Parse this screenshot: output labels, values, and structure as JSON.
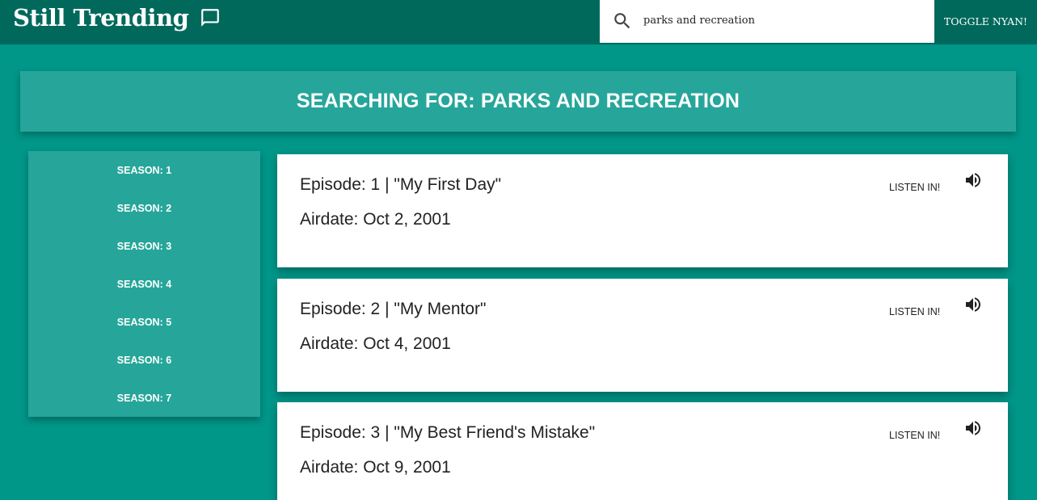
{
  "header": {
    "title": "Still Trending",
    "title_icon": "chat-bubble-icon",
    "search": {
      "icon": "search-icon",
      "value": "parks and recreation"
    },
    "toggle_label": "TOGGLE NYAN!"
  },
  "banner": {
    "text": "SEARCHING FOR: PARKS AND RECREATION"
  },
  "sidebar": {
    "seasons": [
      {
        "label": "SEASON: 1"
      },
      {
        "label": "SEASON: 2"
      },
      {
        "label": "SEASON: 3"
      },
      {
        "label": "SEASON: 4"
      },
      {
        "label": "SEASON: 5"
      },
      {
        "label": "SEASON: 6"
      },
      {
        "label": "SEASON: 7"
      }
    ]
  },
  "episodes": [
    {
      "title": "Episode: 1 | \"My First Day\"",
      "airdate": "Airdate: Oct 2, 2001",
      "listen_label": "LISTEN IN!",
      "icon": "volume-icon"
    },
    {
      "title": "Episode: 2 | \"My Mentor\"",
      "airdate": "Airdate: Oct 4, 2001",
      "listen_label": "LISTEN IN!",
      "icon": "volume-icon"
    },
    {
      "title": "Episode: 3 | \"My Best Friend's Mistake\"",
      "airdate": "Airdate: Oct 9, 2001",
      "listen_label": "LISTEN IN!",
      "icon": "volume-icon"
    }
  ],
  "colors": {
    "background": "#009688",
    "header": "#00695c",
    "panel": "#26a69a",
    "card": "#ffffff"
  }
}
